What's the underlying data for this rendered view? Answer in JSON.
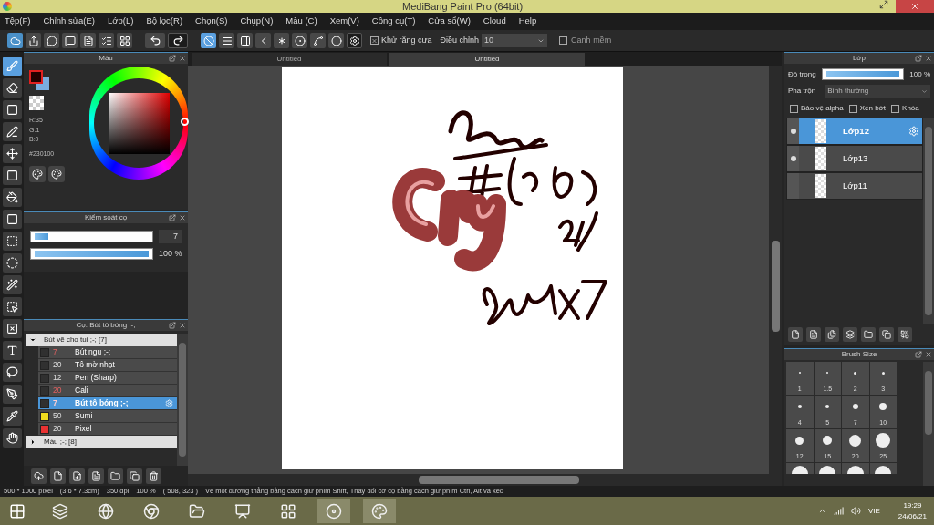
{
  "window": {
    "title": "MediBang Paint Pro (64bit)"
  },
  "menu": [
    "Tệp(F)",
    "Chỉnh sửa(E)",
    "Lớp(L)",
    "Bộ lọc(R)",
    "Chọn(S)",
    "Chụp(N)",
    "Màu (C)",
    "Xem(V)",
    "Công cụ(T)",
    "Cửa sổ(W)",
    "Cloud",
    "Help"
  ],
  "toolbar": {
    "snap_modes": [
      {
        "selected": true
      },
      {
        "selected": false
      },
      {
        "selected": false
      },
      {
        "selected": false
      },
      {
        "selected": false
      },
      {
        "selected": false
      },
      {
        "selected": false
      },
      {
        "selected": false
      }
    ],
    "antialias": {
      "label": "Khử răng cưa",
      "checked": true
    },
    "adjust_label": "Điều chỉnh",
    "adjust_value": "10",
    "smooth": {
      "label": "Canh mềm",
      "checked": false
    }
  },
  "tools": [
    {
      "selected": true
    },
    {
      "selected": false
    },
    {
      "selected": false
    },
    {
      "selected": false
    },
    {
      "selected": false
    },
    {
      "selected": false
    },
    {
      "selected": false
    },
    {
      "selected": false
    },
    {
      "selected": false
    },
    {
      "selected": false
    },
    {
      "selected": false
    },
    {
      "selected": false
    },
    {
      "selected": false
    },
    {
      "selected": false
    },
    {
      "selected": false
    },
    {
      "selected": false
    },
    {
      "selected": false
    },
    {
      "selected": false
    }
  ],
  "color_panel": {
    "title": "Màu",
    "r": "R:35",
    "g": "G:1",
    "b": "B:0",
    "hex": "#230100"
  },
  "brush_control": {
    "title": "Kiểm soát cọ",
    "size": {
      "level": 0.12,
      "value": "7"
    },
    "opacity": {
      "level": 1,
      "value": "100 %"
    }
  },
  "brush_panel": {
    "title": "Cọ: Bút tô bóng ;-;",
    "groups": [
      {
        "name": "Bút vẽ cho tui ;-; [7]",
        "expanded": true,
        "items": [
          {
            "size": "7",
            "size_highlight": true,
            "name": "Bút ngu ;-;",
            "color": "#303030",
            "selected": false
          },
          {
            "size": "20",
            "size_highlight": false,
            "name": "Tô mờ nhạt",
            "color": "#303030",
            "selected": false
          },
          {
            "size": "12",
            "size_highlight": false,
            "name": "Pen (Sharp)",
            "color": "#303030",
            "selected": false
          },
          {
            "size": "20",
            "size_highlight": true,
            "name": "Cali",
            "color": "#303030",
            "selected": false
          },
          {
            "size": "7",
            "size_highlight": true,
            "name": "Bút tô bóng ;-;",
            "color": "#303030",
            "selected": true
          },
          {
            "size": "50",
            "size_highlight": false,
            "name": "Sumi",
            "color": "#f0dc1e",
            "selected": false
          },
          {
            "size": "20",
            "size_highlight": false,
            "name": "Pixel",
            "color": "#e83232",
            "selected": false
          }
        ]
      },
      {
        "name": "Màu ;-; [8]",
        "expanded": false
      }
    ]
  },
  "tabs": [
    {
      "label": "Untitled",
      "selected": false
    },
    {
      "label": "Untitled",
      "selected": true
    }
  ],
  "layer_panel": {
    "title": "Lớp",
    "opacity_label": "Độ trong",
    "opacity": {
      "level": 1,
      "value": "100 %"
    },
    "blend_label": "Pha trộn",
    "blend_value": "Bình thường",
    "options": [
      {
        "label": "Bảo vệ alpha",
        "checked": false
      },
      {
        "label": "Xén bớt",
        "checked": false
      },
      {
        "label": "Khóa",
        "checked": false
      }
    ],
    "layers": [
      {
        "name": "Lớp12",
        "visible": true,
        "selected": true
      },
      {
        "name": "Lớp13",
        "visible": true,
        "selected": false
      },
      {
        "name": "Lớp11",
        "visible": false,
        "selected": false
      }
    ]
  },
  "brush_size": {
    "title": "Brush Size",
    "sizes": [
      "1",
      "1.5",
      "2",
      "3",
      "4",
      "5",
      "7",
      "10",
      "12",
      "15",
      "20",
      "25"
    ]
  },
  "status_bar": [
    "500 * 1000 pixel",
    "(3.6 * 7.3cm)",
    "350 dpi",
    "100 %",
    "( 508, 323 )",
    "Vẽ một đường thẳng bằng cách giữ phím Shift, Thay đổi cỡ cọ bằng cách giữ phím Ctrl, Alt và kéo"
  ],
  "taskbar": {
    "language": "VIE",
    "time": "19:29",
    "date": "24/06/21"
  }
}
